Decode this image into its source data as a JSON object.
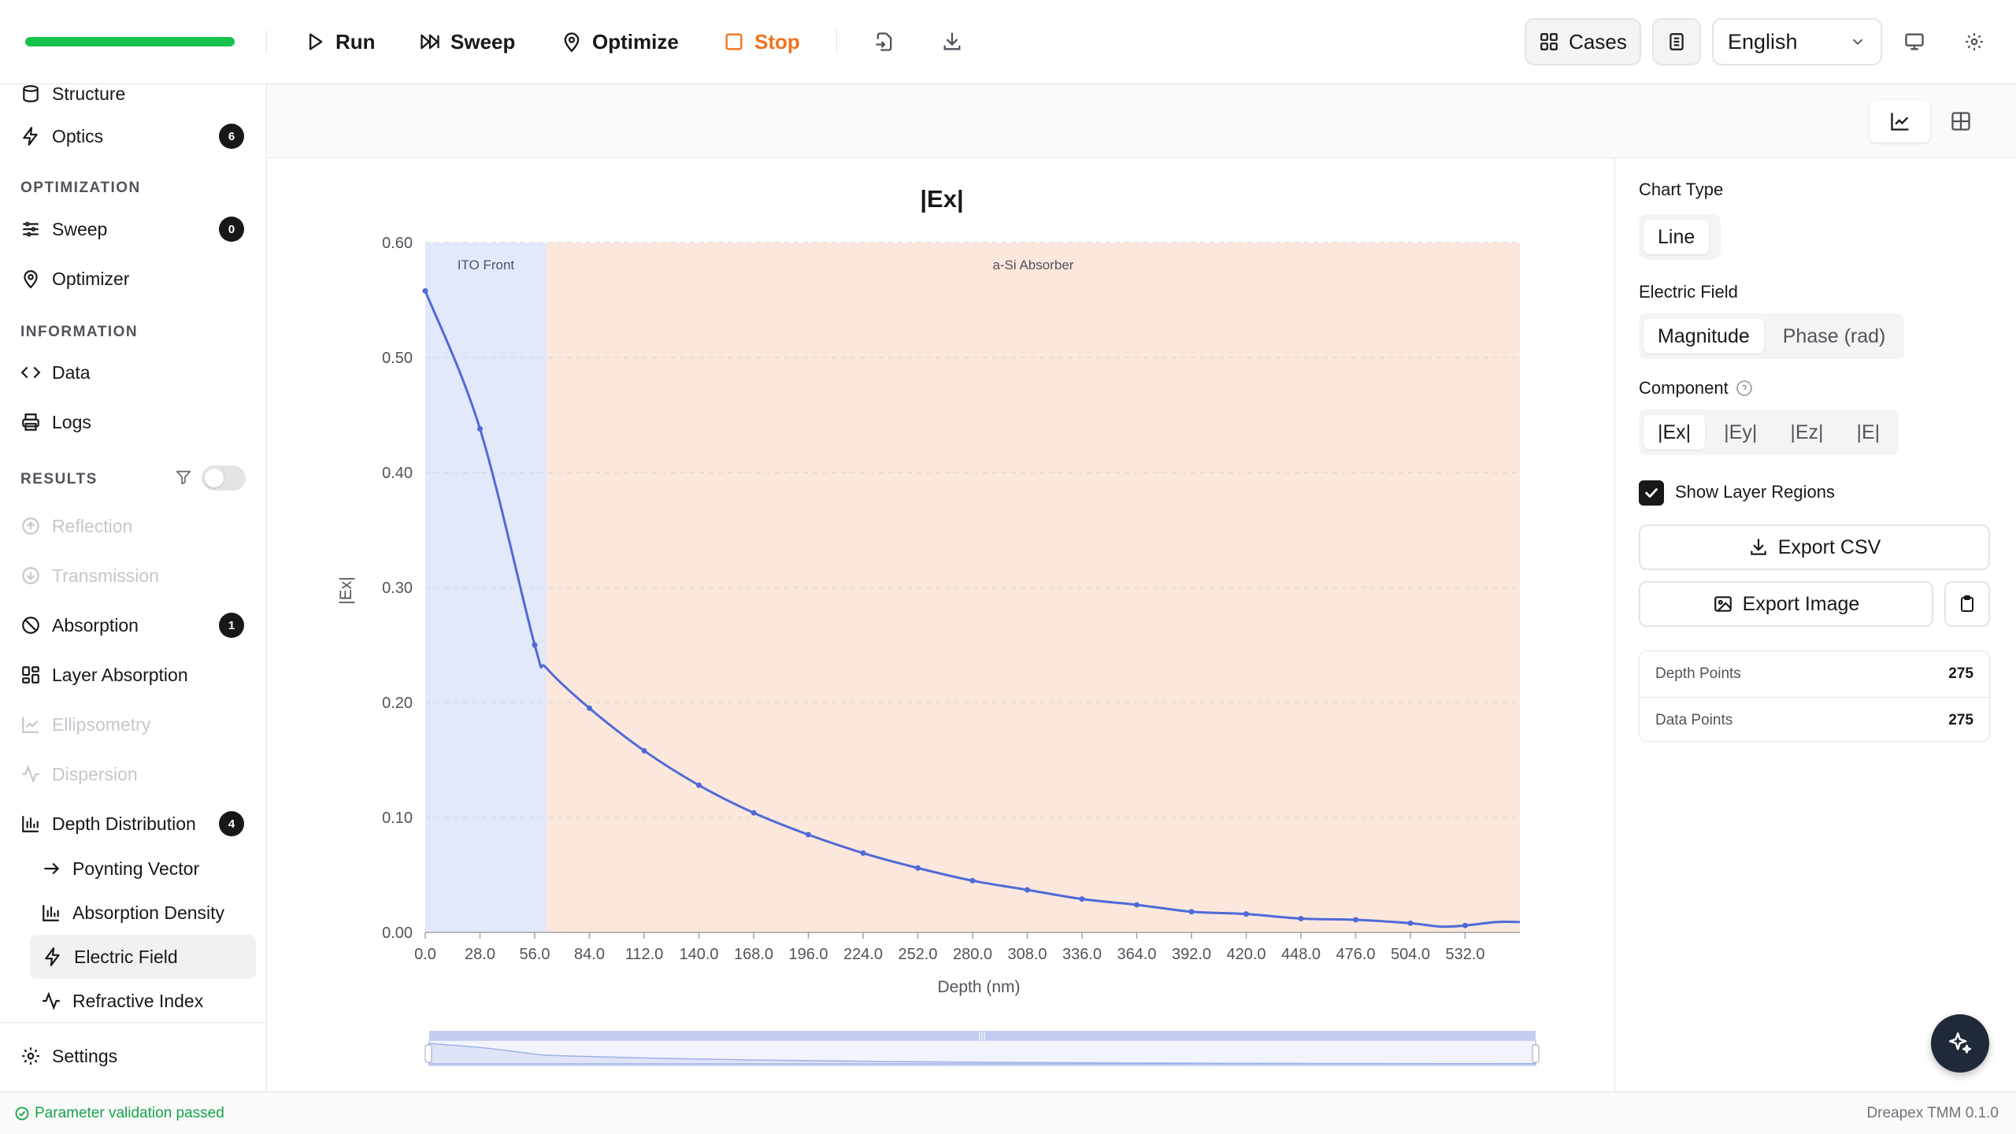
{
  "toolbar": {
    "progress_percent": 100,
    "run_label": "Run",
    "sweep_label": "Sweep",
    "optimize_label": "Optimize",
    "stop_label": "Stop",
    "cases_label": "Cases",
    "language": "English"
  },
  "sidebar": {
    "top_items": [
      {
        "label": "Structure"
      },
      {
        "label": "Optics",
        "badge": "6"
      }
    ],
    "optimization_heading": "OPTIMIZATION",
    "optimization_items": [
      {
        "label": "Sweep",
        "badge": "0"
      },
      {
        "label": "Optimizer"
      }
    ],
    "information_heading": "INFORMATION",
    "information_items": [
      {
        "label": "Data"
      },
      {
        "label": "Logs"
      }
    ],
    "results_heading": "RESULTS",
    "results_items": [
      {
        "label": "Reflection"
      },
      {
        "label": "Transmission"
      },
      {
        "label": "Absorption",
        "badge": "1"
      },
      {
        "label": "Layer Absorption"
      },
      {
        "label": "Ellipsometry"
      },
      {
        "label": "Dispersion"
      },
      {
        "label": "Depth Distribution",
        "badge": "4"
      }
    ],
    "depth_sub_items": [
      {
        "label": "Poynting Vector"
      },
      {
        "label": "Absorption Density"
      },
      {
        "label": "Electric Field"
      },
      {
        "label": "Refractive Index"
      }
    ],
    "settings_label": "Settings"
  },
  "right_panel": {
    "chart_type_label": "Chart Type",
    "chart_type_value": "Line",
    "electric_field_label": "Electric Field",
    "field_options": [
      "Magnitude",
      "Phase (rad)"
    ],
    "component_label": "Component",
    "component_options": [
      "|Ex|",
      "|Ey|",
      "|Ez|",
      "|E|"
    ],
    "show_layers_label": "Show Layer Regions",
    "export_csv_label": "Export CSV",
    "export_image_label": "Export Image",
    "stats": [
      {
        "label": "Depth Points",
        "value": "275"
      },
      {
        "label": "Data Points",
        "value": "275"
      }
    ]
  },
  "status": {
    "message": "Parameter validation passed",
    "version": "Dreapex TMM 0.1.0"
  },
  "chart_data": {
    "type": "line",
    "title": "|Ex|",
    "xlabel": "Depth (nm)",
    "ylabel": "|Ex|",
    "xlim": [
      0,
      560
    ],
    "ylim": [
      0,
      0.6
    ],
    "x_ticks": [
      "0.0",
      "28.0",
      "56.0",
      "84.0",
      "112.0",
      "140.0",
      "168.0",
      "196.0",
      "224.0",
      "252.0",
      "280.0",
      "308.0",
      "336.0",
      "364.0",
      "392.0",
      "420.0",
      "448.0",
      "476.0",
      "504.0",
      "532.0"
    ],
    "y_ticks": [
      "0.00",
      "0.10",
      "0.20",
      "0.30",
      "0.40",
      "0.50",
      "0.60"
    ],
    "grid": true,
    "layer_regions": [
      {
        "name": "ITO Front",
        "start": 0,
        "end": 62,
        "color": "#e1e9fb"
      },
      {
        "name": "a-Si Absorber",
        "start": 62,
        "end": 560,
        "color": "#fce7dc"
      }
    ],
    "series": [
      {
        "color": "#4f6ad8",
        "x": [
          0,
          28,
          56,
          62,
          84,
          112,
          140,
          168,
          196,
          224,
          252,
          280,
          308,
          336,
          364,
          392,
          420,
          448,
          476,
          504,
          520,
          532,
          548,
          560
        ],
        "y": [
          0.558,
          0.438,
          0.25,
          0.23,
          0.195,
          0.158,
          0.128,
          0.104,
          0.085,
          0.069,
          0.056,
          0.045,
          0.037,
          0.029,
          0.024,
          0.018,
          0.016,
          0.012,
          0.011,
          0.008,
          0.005,
          0.006,
          0.009,
          0.009
        ],
        "markers_x": [
          0,
          28,
          56,
          84,
          112,
          140,
          168,
          196,
          224,
          252,
          280,
          308,
          336,
          364,
          392,
          420,
          448,
          476,
          504,
          532
        ]
      }
    ]
  }
}
